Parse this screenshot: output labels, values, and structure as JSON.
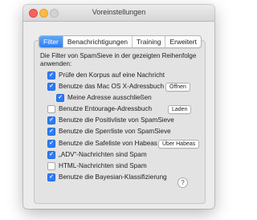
{
  "window": {
    "title": "Voreinstellungen"
  },
  "tabs": [
    {
      "label": "Filter",
      "active": true
    },
    {
      "label": "Benachrichtigungen",
      "active": false
    },
    {
      "label": "Training",
      "active": false
    },
    {
      "label": "Erweitert",
      "active": false
    }
  ],
  "intro": "Die Filter von SpamSieve in der gezeigten Reihenfolge anwenden:",
  "options": [
    {
      "label": "Prüfe den Korpus auf eine Nachricht",
      "checked": true
    },
    {
      "label": "Benutze das Mac OS X-Adressbuch",
      "checked": true,
      "button": "Öffnen"
    },
    {
      "label": "Meine Adresse ausschließen",
      "checked": true
    },
    {
      "label": "Benutze Entourage-Adressbuch",
      "checked": false,
      "button": "Laden"
    },
    {
      "label": "Benutze die Positivliste von SpamSieve",
      "checked": true
    },
    {
      "label": "Benutze die Sperrliste von SpamSieve",
      "checked": true
    },
    {
      "label": "Benutze die Safeliste von Habeas",
      "checked": true,
      "button": "Über Habeas"
    },
    {
      "label": "„ADV“-Nachrichten sind Spam",
      "checked": true
    },
    {
      "label": "HTML-Nachrichten sind Spam",
      "checked": false
    },
    {
      "label": "Benutze die Bayesian-Klassifizierung",
      "checked": true
    }
  ],
  "help": {
    "label": "?"
  },
  "colors": {
    "accent": "#2f7cf6",
    "close": "#fc605c",
    "minimize": "#fdbc40"
  }
}
